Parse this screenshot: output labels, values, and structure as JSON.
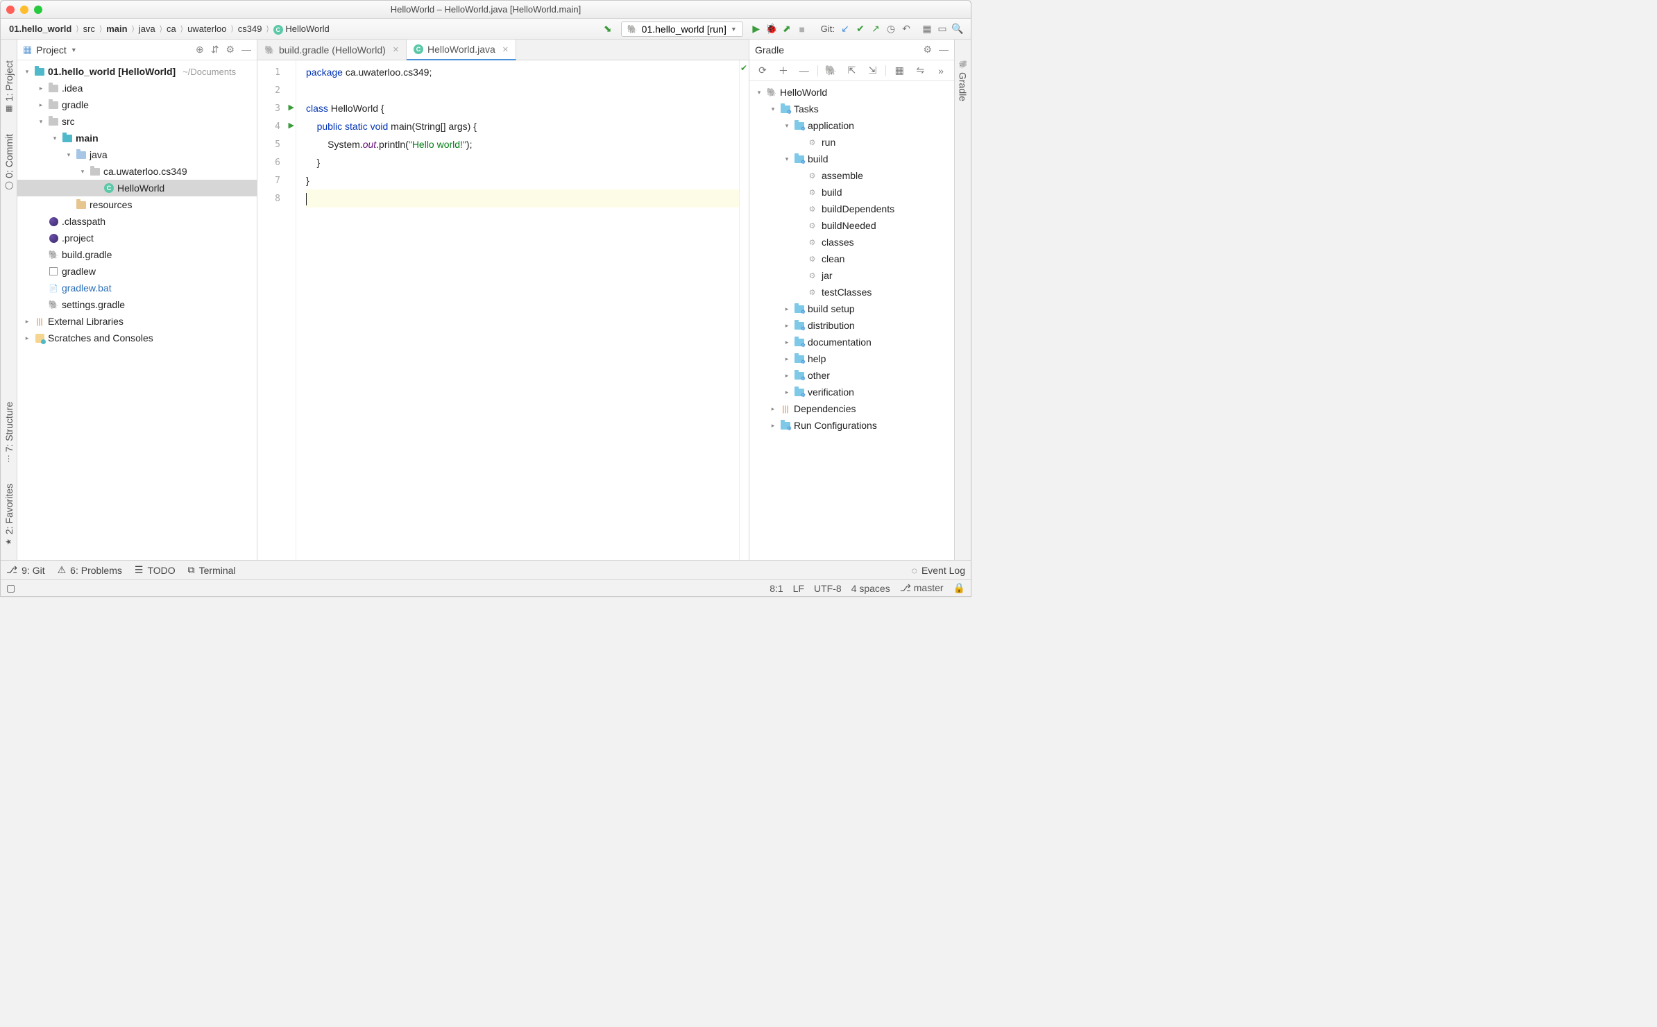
{
  "window": {
    "title": "HelloWorld – HelloWorld.java [HelloWorld.main]"
  },
  "breadcrumbs": [
    "01.hello_world",
    "src",
    "main",
    "java",
    "ca",
    "uwaterloo",
    "cs349",
    "HelloWorld"
  ],
  "run_config": {
    "label": "01.hello_world [run]"
  },
  "git_label": "Git:",
  "left_tabs": {
    "project": "1: Project",
    "commit": "0: Commit",
    "structure": "7: Structure",
    "favorites": "2: Favorites"
  },
  "right_tabs": {
    "gradle": "Gradle"
  },
  "project_panel": {
    "title": "Project",
    "tree": [
      {
        "d": 0,
        "arr": "down",
        "icon": "folder-teal",
        "label": "01.hello_world",
        "bold": true,
        "suffix": " [HelloWorld]",
        "hint": "~/Documents"
      },
      {
        "d": 1,
        "arr": "right",
        "icon": "folder-gray",
        "label": ".idea"
      },
      {
        "d": 1,
        "arr": "right",
        "icon": "folder-gray",
        "label": "gradle"
      },
      {
        "d": 1,
        "arr": "down",
        "icon": "folder-gray",
        "label": "src"
      },
      {
        "d": 2,
        "arr": "down",
        "icon": "folder-teal",
        "label": "main",
        "bold": true
      },
      {
        "d": 3,
        "arr": "down",
        "icon": "folder-blue",
        "label": "java"
      },
      {
        "d": 4,
        "arr": "down",
        "icon": "folder-gray",
        "label": "ca.uwaterloo.cs349"
      },
      {
        "d": 5,
        "arr": "none",
        "icon": "class",
        "label": "HelloWorld",
        "selected": true
      },
      {
        "d": 3,
        "arr": "none",
        "icon": "folder-orange",
        "label": "resources"
      },
      {
        "d": 1,
        "arr": "none",
        "icon": "eclipse",
        "label": ".classpath"
      },
      {
        "d": 1,
        "arr": "none",
        "icon": "eclipse",
        "label": ".project"
      },
      {
        "d": 1,
        "arr": "none",
        "icon": "eleph",
        "label": "build.gradle"
      },
      {
        "d": 1,
        "arr": "none",
        "icon": "sq",
        "label": "gradlew"
      },
      {
        "d": 1,
        "arr": "none",
        "icon": "file",
        "label": "gradlew.bat",
        "link": true
      },
      {
        "d": 1,
        "arr": "none",
        "icon": "eleph",
        "label": "settings.gradle"
      },
      {
        "d": 0,
        "arr": "right",
        "icon": "lib",
        "label": "External Libraries"
      },
      {
        "d": 0,
        "arr": "right",
        "icon": "scratch",
        "label": "Scratches and Consoles"
      }
    ]
  },
  "editor_tabs": [
    {
      "icon": "eleph",
      "label": "build.gradle (HelloWorld)",
      "active": false
    },
    {
      "icon": "class",
      "label": "HelloWorld.java",
      "active": true
    }
  ],
  "code": {
    "line_count": 8,
    "run_markers": [
      3,
      4
    ],
    "highlight": 8,
    "lines": {
      "l1": [
        {
          "t": "package ",
          "c": "kw"
        },
        {
          "t": "ca.uwaterloo.cs349;"
        }
      ],
      "l3": [
        {
          "t": "class ",
          "c": "kw"
        },
        {
          "t": "HelloWorld {"
        }
      ],
      "l4": [
        {
          "t": "    "
        },
        {
          "t": "public static void ",
          "c": "kw"
        },
        {
          "t": "main(String[] args) {"
        }
      ],
      "l5": [
        {
          "t": "        System."
        },
        {
          "t": "out",
          "c": "it"
        },
        {
          "t": ".println("
        },
        {
          "t": "\"Hello world!\"",
          "c": "str"
        },
        {
          "t": ");"
        }
      ],
      "l6": [
        {
          "t": "    }"
        }
      ],
      "l7": [
        {
          "t": "}"
        }
      ]
    }
  },
  "gradle_panel": {
    "title": "Gradle",
    "tree": [
      {
        "d": 0,
        "arr": "down",
        "icon": "eleph",
        "label": "HelloWorld"
      },
      {
        "d": 1,
        "arr": "down",
        "icon": "folder-g",
        "label": "Tasks"
      },
      {
        "d": 2,
        "arr": "down",
        "icon": "folder-g",
        "label": "application"
      },
      {
        "d": 3,
        "arr": "none",
        "icon": "gear",
        "label": "run"
      },
      {
        "d": 2,
        "arr": "down",
        "icon": "folder-g",
        "label": "build"
      },
      {
        "d": 3,
        "arr": "none",
        "icon": "gear",
        "label": "assemble"
      },
      {
        "d": 3,
        "arr": "none",
        "icon": "gear",
        "label": "build"
      },
      {
        "d": 3,
        "arr": "none",
        "icon": "gear",
        "label": "buildDependents"
      },
      {
        "d": 3,
        "arr": "none",
        "icon": "gear",
        "label": "buildNeeded"
      },
      {
        "d": 3,
        "arr": "none",
        "icon": "gear",
        "label": "classes"
      },
      {
        "d": 3,
        "arr": "none",
        "icon": "gear",
        "label": "clean"
      },
      {
        "d": 3,
        "arr": "none",
        "icon": "gear",
        "label": "jar"
      },
      {
        "d": 3,
        "arr": "none",
        "icon": "gear",
        "label": "testClasses"
      },
      {
        "d": 2,
        "arr": "right",
        "icon": "folder-g",
        "label": "build setup"
      },
      {
        "d": 2,
        "arr": "right",
        "icon": "folder-g",
        "label": "distribution"
      },
      {
        "d": 2,
        "arr": "right",
        "icon": "folder-g",
        "label": "documentation"
      },
      {
        "d": 2,
        "arr": "right",
        "icon": "folder-g",
        "label": "help"
      },
      {
        "d": 2,
        "arr": "right",
        "icon": "folder-g",
        "label": "other"
      },
      {
        "d": 2,
        "arr": "right",
        "icon": "folder-g",
        "label": "verification"
      },
      {
        "d": 1,
        "arr": "right",
        "icon": "lib",
        "label": "Dependencies"
      },
      {
        "d": 1,
        "arr": "right",
        "icon": "folder-g",
        "label": "Run Configurations"
      }
    ]
  },
  "bottom_tabs": {
    "git": "9: Git",
    "problems": "6: Problems",
    "todo": "TODO",
    "terminal": "Terminal",
    "eventlog": "Event Log"
  },
  "status": {
    "pos": "8:1",
    "lf": "LF",
    "enc": "UTF-8",
    "indent": "4 spaces",
    "branch": "master"
  }
}
